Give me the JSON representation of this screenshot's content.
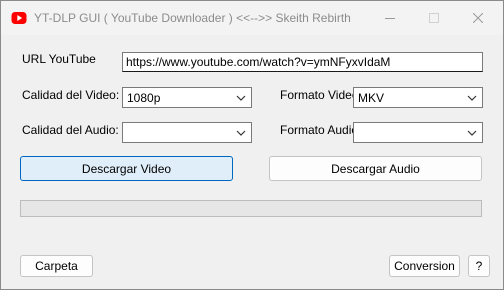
{
  "window": {
    "title": "YT-DLP GUI ( YouTube Downloader ) <<-->> Skeith Rebirth"
  },
  "form": {
    "url_label": "URL YouTube",
    "url_value": "https://www.youtube.com/watch?v=ymNFyxvIdaM",
    "video_quality_label": "Calidad del Video:",
    "video_quality_value": "1080p",
    "video_format_label": "Formato Video:",
    "video_format_value": "MKV",
    "audio_quality_label": "Calidad del Audio:",
    "audio_quality_value": "",
    "audio_format_label": "Formato Audio:",
    "audio_format_value": ""
  },
  "actions": {
    "download_video": "Descargar Video",
    "download_audio": "Descargar Audio",
    "folder": "Carpeta",
    "convert": "Conversion",
    "help": "?"
  },
  "progress": {
    "value": 0
  },
  "icons": {
    "app": "youtube-logo-icon",
    "minimize": "minimize-icon",
    "maximize": "maximize-icon",
    "close": "close-icon",
    "dropdown": "chevron-down-icon"
  },
  "colors": {
    "accent": "#0067c0",
    "app_icon": "#ff0000"
  }
}
